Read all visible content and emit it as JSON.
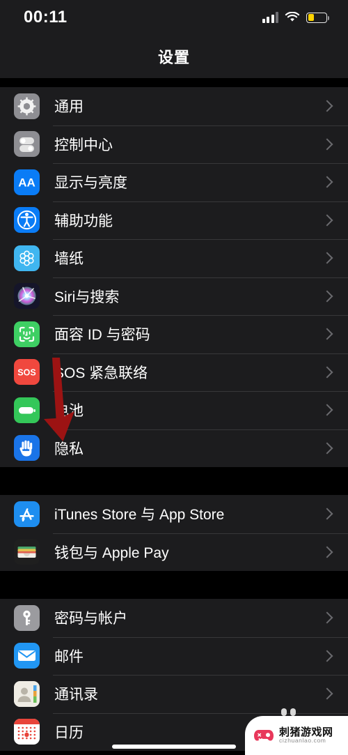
{
  "status_bar": {
    "time": "00:11",
    "signal_icon": "cellular-signal-icon",
    "wifi_icon": "wifi-icon",
    "battery_icon": "battery-low-power-icon",
    "battery_fill_percent": 32,
    "battery_fill_color": "#fdd300"
  },
  "nav": {
    "title": "设置"
  },
  "colors": {
    "screen_background": "#000000",
    "row_background": "#1c1c1e",
    "separator": "#38383a",
    "label_text": "#ffffff",
    "chevron": "#6a6a6e",
    "arrow_annotation": "#9c1313",
    "accent_blue": "#0a84ff",
    "accent_green": "#34c759",
    "accent_red": "#f0483e",
    "accent_gray": "#8e8e93"
  },
  "groups": [
    {
      "id": "group-system",
      "rows": [
        {
          "label": "通用",
          "icon": "gear-icon",
          "icon_color": "#8e8e93",
          "chevron": "chevron-right-icon"
        },
        {
          "label": "控制中心",
          "icon": "control-center-toggles-icon",
          "icon_color": "#8e8e93",
          "chevron": "chevron-right-icon"
        },
        {
          "label": "显示与亮度",
          "icon": "display-brightness-aa-icon",
          "icon_color": "#0a7cf6",
          "chevron": "chevron-right-icon"
        },
        {
          "label": "辅助功能",
          "icon": "accessibility-icon",
          "icon_color": "#0a7cf6",
          "chevron": "chevron-right-icon"
        },
        {
          "label": "墙纸",
          "icon": "wallpaper-flower-icon",
          "icon_color": "#40b6f0",
          "chevron": "chevron-right-icon"
        },
        {
          "label": "Siri与搜索",
          "icon": "siri-orb-icon",
          "icon_color": "#1b1b2e",
          "chevron": "chevron-right-icon"
        },
        {
          "label": "面容 ID 与密码",
          "icon": "face-id-icon",
          "icon_color": "#3ecf63",
          "chevron": "chevron-right-icon"
        },
        {
          "label": "SOS 紧急联络",
          "icon": "sos-icon",
          "icon_color": "#f0483e",
          "chevron": "chevron-right-icon"
        },
        {
          "label": "电池",
          "icon": "battery-green-icon",
          "icon_color": "#34c759",
          "chevron": "chevron-right-icon"
        },
        {
          "label": "隐私",
          "icon": "privacy-hand-icon",
          "icon_color": "#1a74e8",
          "chevron": "chevron-right-icon"
        }
      ]
    },
    {
      "id": "group-store",
      "rows": [
        {
          "label": "iTunes Store 与 App Store",
          "icon": "app-store-icon",
          "icon_color": "#1e8ef0",
          "chevron": "chevron-right-icon"
        },
        {
          "label": "钱包与 Apple Pay",
          "icon": "wallet-icon",
          "icon_color": "#2a2a2a",
          "chevron": "chevron-right-icon"
        }
      ]
    },
    {
      "id": "group-accounts",
      "rows": [
        {
          "label": "密码与帐户",
          "icon": "key-icon",
          "icon_color": "#9b9b9f",
          "chevron": "chevron-right-icon"
        },
        {
          "label": "邮件",
          "icon": "mail-envelope-icon",
          "icon_color": "#2196f3",
          "chevron": "chevron-right-icon"
        },
        {
          "label": "通讯录",
          "icon": "contacts-icon",
          "icon_color": "#e8e4dc",
          "chevron": "chevron-right-icon"
        },
        {
          "label": "日历",
          "icon": "calendar-icon",
          "icon_color": "#ffffff",
          "chevron": "chevron-right-icon"
        }
      ]
    }
  ],
  "annotation": {
    "arrow_icon": "down-arrow-annotation",
    "arrow_color": "#9c1313",
    "points_at": "隐私"
  },
  "watermark": {
    "title": "刺猪游戏网",
    "url": "cizhuanlao.com",
    "icon": "gamepad-icon",
    "icon_color": "#e8375a"
  },
  "home_indicator": {
    "icon": "home-indicator"
  }
}
